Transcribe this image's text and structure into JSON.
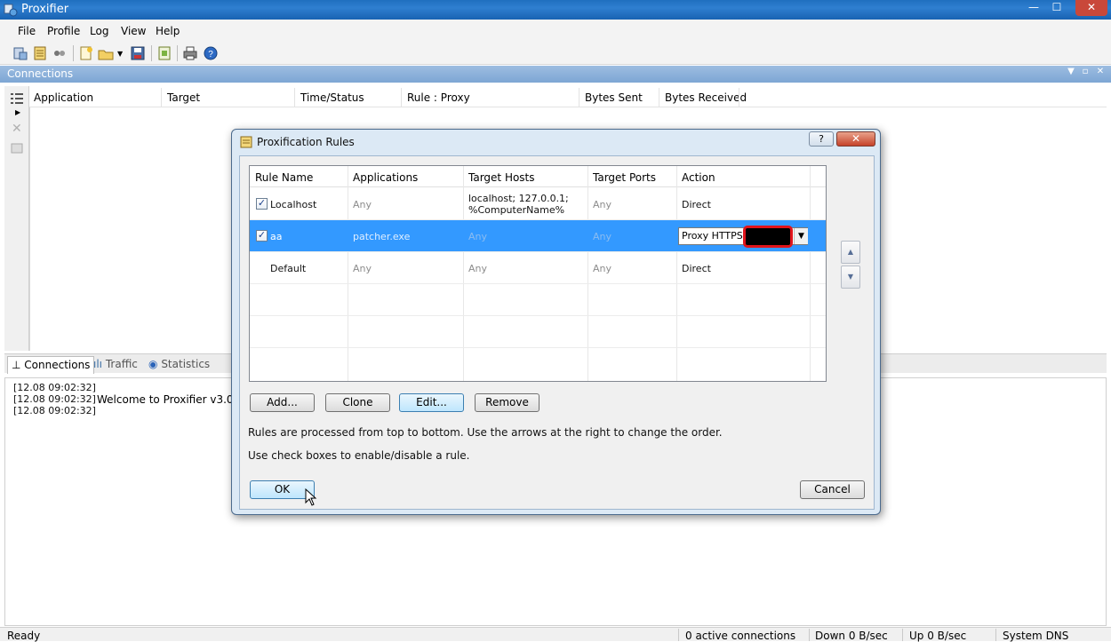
{
  "window": {
    "title": "Proxifier",
    "controls": {
      "minimize": "—",
      "maximize": "☐",
      "close": "✕"
    }
  },
  "menu": [
    "File",
    "Profile",
    "Log",
    "View",
    "Help"
  ],
  "connections": {
    "panel_title": "Connections",
    "columns": [
      "Application",
      "Target",
      "Time/Status",
      "Rule : Proxy",
      "Bytes Sent",
      "Bytes Received"
    ]
  },
  "tabs": [
    {
      "label": "Connections",
      "icon": "connections-icon",
      "active": true
    },
    {
      "label": "Traffic",
      "icon": "traffic-icon",
      "active": false
    },
    {
      "label": "Statistics",
      "icon": "statistics-icon",
      "active": false
    }
  ],
  "log": {
    "timestamps": [
      "[12.08 09:02:32]",
      "[12.08 09:02:32]",
      "[12.08 09:02:32]"
    ],
    "message": "Welcome to Proxifier v3.0"
  },
  "status": {
    "left": "Ready",
    "active": "0 active connections",
    "down": "Down 0 B/sec",
    "up": "Up 0 B/sec",
    "dns": "System DNS"
  },
  "dialog": {
    "title": "Proxification Rules",
    "help": "?",
    "close": "✕",
    "columns": [
      "Rule Name",
      "Applications",
      "Target Hosts",
      "Target Ports",
      "Action"
    ],
    "rules": [
      {
        "enabled": true,
        "name": "Localhost",
        "applications": "Any",
        "hosts_line1": "localhost; 127.0.0.1;",
        "hosts_line2": "%ComputerName%",
        "ports": "Any",
        "action": "Direct",
        "selected": false
      },
      {
        "enabled": true,
        "name": "aa",
        "applications": "patcher.exe",
        "hosts_line1": "Any",
        "hosts_line2": "",
        "ports": "Any",
        "action": "Proxy HTTPS 1",
        "selected": true
      },
      {
        "enabled": null,
        "name": "Default",
        "applications": "Any",
        "hosts_line1": "Any",
        "hosts_line2": "",
        "ports": "Any",
        "action": "Direct",
        "selected": false
      }
    ],
    "buttons": {
      "add": "Add...",
      "clone": "Clone",
      "edit": "Edit...",
      "remove": "Remove",
      "ok": "OK",
      "cancel": "Cancel"
    },
    "hint1": "Rules are processed from top to bottom. Use the arrows at the right to change the order.",
    "hint2": "Use check boxes to enable/disable a rule.",
    "check_mark": "✓",
    "arrow_up": "▲",
    "arrow_down": "▼"
  },
  "colors": {
    "selection": "#3399ff",
    "titlebar": "#1f6fbf",
    "redaction": "#e0141b"
  }
}
